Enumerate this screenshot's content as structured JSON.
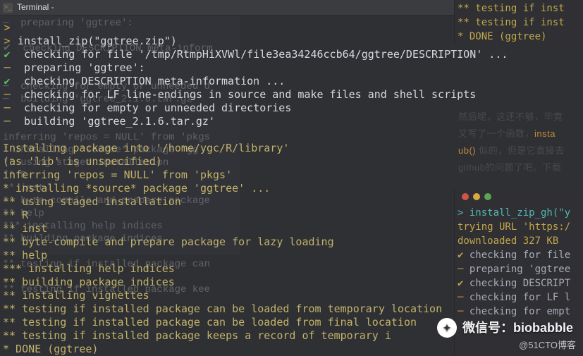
{
  "window": {
    "title": "Terminal -"
  },
  "ghost": {
    "lines": [
      "─  preparing 'ggtree':",
      "",
      "✔  checking DESCRIPTION meta-inform",
      "",
      "",
      "─  checking for empty or unneeded d",
      "─  building 'ggtree_2.1.6.tar.gz'",
      "",
      "",
      "inferring 'repos = NULL' from 'pkgs",
      "* installing *source* package 'gg",
      "** using staged installation",
      "** R",
      "** inst",
      "** byte-compile and prepare package",
      "** help",
      "*** installing help indices",
      "** building package indices",
      "",
      "** testing if installed package can",
      "",
      "** testing if installed package kee"
    ]
  },
  "term": {
    "lines": [
      {
        "mark": ">",
        "markClass": "yellow",
        "text": ""
      },
      {
        "mark": ">",
        "markClass": "yellow",
        "text": " install_zip(\"ggtree.zip\")",
        "textClass": "white"
      },
      {
        "mark": "✔",
        "markClass": "green",
        "text": "  checking for file '/tmp/RtmpHiXVWl/file3ea34246ccb64/ggtree/DESCRIPTION' ...",
        "textClass": "white"
      },
      {
        "mark": "─",
        "markClass": "yellow",
        "text": "  preparing 'ggtree':",
        "textClass": "white"
      },
      {
        "mark": "✔",
        "markClass": "green",
        "text": "  checking DESCRIPTION meta-information ...",
        "textClass": "white"
      },
      {
        "mark": "─",
        "markClass": "yellow",
        "text": "  checking for LF line-endings in source and make files and shell scripts",
        "textClass": "white"
      },
      {
        "mark": "─",
        "markClass": "yellow",
        "text": "  checking for empty or unneeded directories",
        "textClass": "white"
      },
      {
        "mark": "─",
        "markClass": "yellow",
        "text": "  building 'ggtree_2.1.6.tar.gz'",
        "textClass": "white"
      },
      {
        "mark": "",
        "markClass": "",
        "text": "   "
      },
      {
        "mark": "",
        "markClass": "",
        "text": "Installing package into '/home/ygc/R/library'",
        "textClass": "gray"
      },
      {
        "mark": "",
        "markClass": "",
        "text": "(as 'lib' is unspecified)",
        "textClass": "gray"
      },
      {
        "mark": "",
        "markClass": "",
        "text": "inferring 'repos = NULL' from 'pkgs'",
        "textClass": "gray"
      },
      {
        "mark": "",
        "markClass": "",
        "text": "* installing *source* package 'ggtree' ...",
        "textClass": "gray"
      },
      {
        "mark": "",
        "markClass": "",
        "text": "** using staged installation",
        "textClass": "gray"
      },
      {
        "mark": "",
        "markClass": "",
        "text": "** R",
        "textClass": "gray"
      },
      {
        "mark": "",
        "markClass": "",
        "text": "** inst",
        "textClass": "gray"
      },
      {
        "mark": "",
        "markClass": "",
        "text": "** byte-compile and prepare package for lazy loading",
        "textClass": "gray"
      },
      {
        "mark": "",
        "markClass": "",
        "text": "** help",
        "textClass": "gray"
      },
      {
        "mark": "",
        "markClass": "",
        "text": "*** installing help indices",
        "textClass": "gray"
      },
      {
        "mark": "",
        "markClass": "",
        "text": "** building package indices",
        "textClass": "gray"
      },
      {
        "mark": "",
        "markClass": "",
        "text": "** installing vignettes",
        "textClass": "gray"
      },
      {
        "mark": "",
        "markClass": "",
        "text": "** testing if installed package can be loaded from temporary location",
        "textClass": "gray"
      },
      {
        "mark": "",
        "markClass": "",
        "text": "** testing if installed package can be loaded from final location",
        "textClass": "gray"
      },
      {
        "mark": "",
        "markClass": "",
        "text": "** testing if installed package keeps a record of temporary i",
        "textClass": "gray"
      },
      {
        "mark": "",
        "markClass": "",
        "text": "* DONE (ggtree)",
        "textClass": "gray"
      }
    ]
  },
  "right_top": {
    "lines": [
      "** testing if inst",
      "** testing if inst",
      "* DONE (ggtree)"
    ]
  },
  "right_text": {
    "l1": "然后呢，这还不够，毕竟",
    "l2": "又写了一个函数，",
    "l2b": "insta",
    "l3a": "ub()",
    "l3b": " 似的，但是它直接去",
    "l4": "github的问题了吧。下载"
  },
  "right_bot": {
    "lines": [
      {
        "t": "> install_zip_gh(\"y",
        "c": "c"
      },
      {
        "t": "trying URL 'https:/",
        "c": "g"
      },
      {
        "t": "downloaded 327 KB",
        "c": "g"
      },
      {
        "t": " "
      },
      {
        "t": "  checking for file",
        "c": "",
        "pre": "✔",
        "preC": "g",
        "mid": " for ",
        "midC": "b"
      },
      {
        "t": "  preparing 'ggtree",
        "c": "",
        "pre": "─",
        "preC": "o"
      },
      {
        "t": "  checking DESCRIPT",
        "c": "",
        "pre": "✔",
        "preC": "g"
      },
      {
        "t": "  checking for LF l",
        "c": "",
        "pre": "─",
        "preC": "o",
        "mid": " for ",
        "midC": "b"
      },
      {
        "t": "  checking for empt",
        "c": "",
        "pre": "─",
        "preC": "o",
        "mid": " for ",
        "midC": "b"
      }
    ]
  },
  "watermark1": "微信号：biobabble",
  "watermark2": "@51CTO博客"
}
